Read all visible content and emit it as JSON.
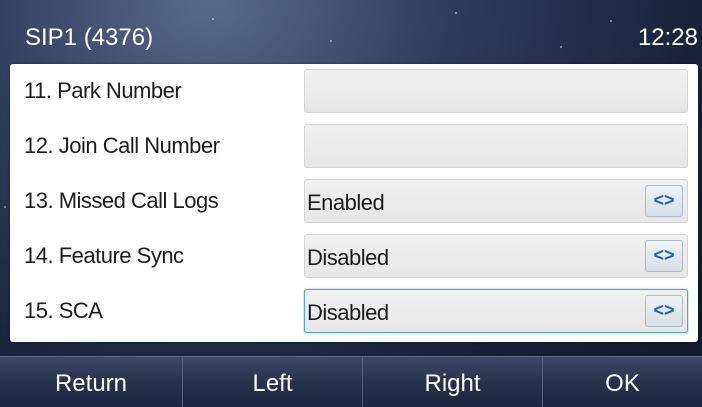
{
  "status_bar": {
    "account": "SIP1 (4376)",
    "time": "12:28"
  },
  "settings": [
    {
      "index": "11.",
      "label": "Park Number",
      "value": "",
      "type": "text"
    },
    {
      "index": "12.",
      "label": "Join Call Number",
      "value": "",
      "type": "text"
    },
    {
      "index": "13.",
      "label": "Missed Call Logs",
      "value": "Enabled",
      "type": "switch"
    },
    {
      "index": "14.",
      "label": "Feature Sync",
      "value": "Disabled",
      "type": "switch"
    },
    {
      "index": "15.",
      "label": "SCA",
      "value": "Disabled",
      "type": "switch",
      "focused": true
    }
  ],
  "switch_icon_glyph": "<>",
  "softkeys": {
    "return": "Return",
    "left": "Left",
    "right": "Right",
    "ok": "OK"
  },
  "colors": {
    "switch_arrow": "#1f63b8",
    "focus_border": "#5aa6b4"
  }
}
